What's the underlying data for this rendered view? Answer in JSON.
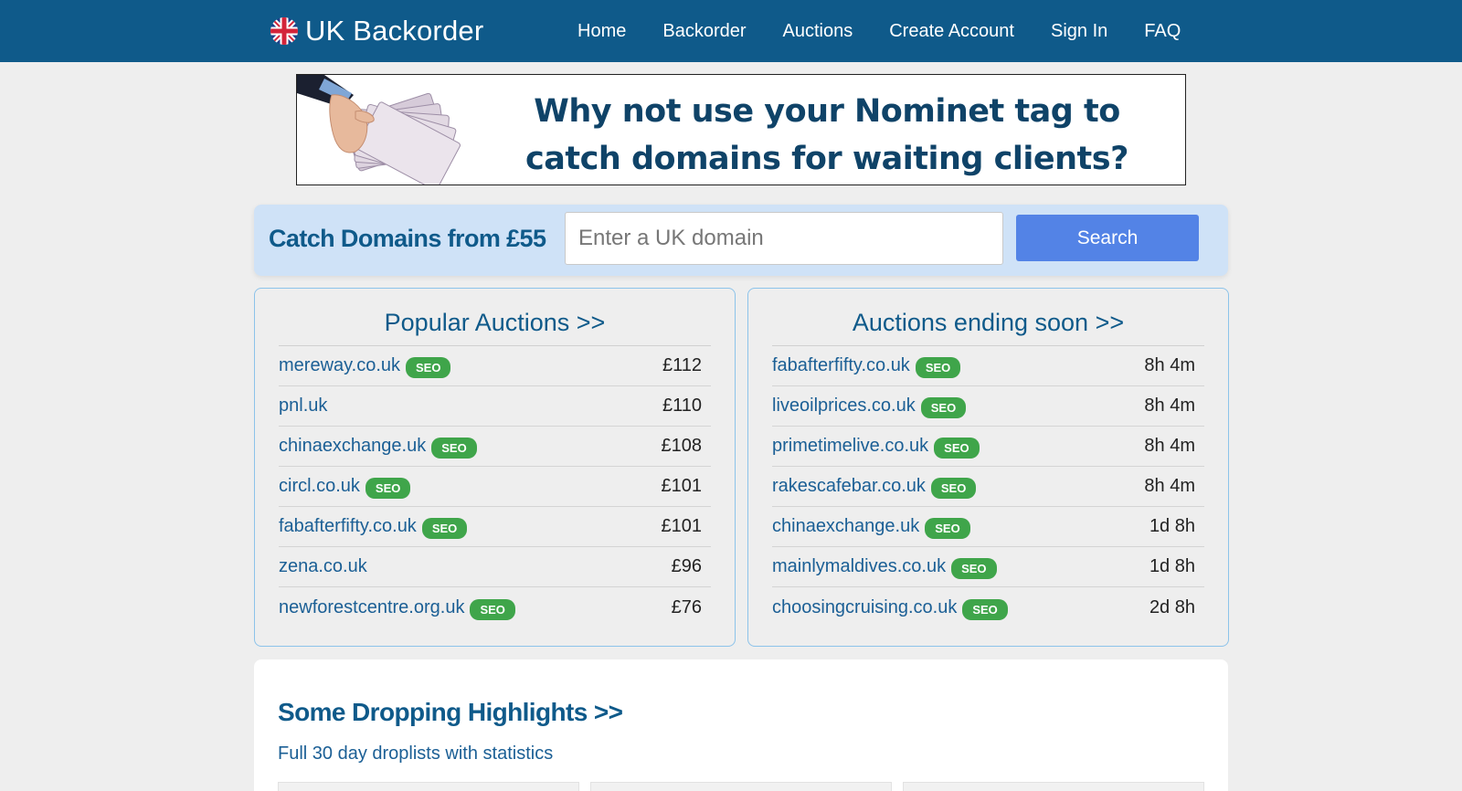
{
  "nav": {
    "brand": "UK Backorder",
    "brand_icon": "union-jack-flag-icon",
    "links": [
      "Home",
      "Backorder",
      "Auctions",
      "Create Account",
      "Sign In",
      "FAQ"
    ]
  },
  "banner": {
    "headline": "Why not use your Nominet tag to catch domains for waiting clients?",
    "image": "hand-holding-banknotes-image"
  },
  "search": {
    "title": "Catch Domains from £55",
    "placeholder": "Enter a UK domain",
    "button": "Search"
  },
  "popular": {
    "title": "Popular Auctions >>",
    "rows": [
      {
        "domain": "mereway.co.uk",
        "seo": true,
        "value": "£112"
      },
      {
        "domain": "pnl.uk",
        "seo": false,
        "value": "£110"
      },
      {
        "domain": "chinaexchange.uk",
        "seo": true,
        "value": "£108"
      },
      {
        "domain": "circl.co.uk",
        "seo": true,
        "value": "£101"
      },
      {
        "domain": "fabafterfifty.co.uk",
        "seo": true,
        "value": "£101"
      },
      {
        "domain": "zena.co.uk",
        "seo": false,
        "value": "£96"
      },
      {
        "domain": "newforestcentre.org.uk",
        "seo": true,
        "value": "£76"
      }
    ]
  },
  "ending": {
    "title": "Auctions ending soon >>",
    "rows": [
      {
        "domain": "fabafterfifty.co.uk",
        "seo": true,
        "value": "8h 4m"
      },
      {
        "domain": "liveoilprices.co.uk",
        "seo": true,
        "value": "8h 4m"
      },
      {
        "domain": "primetimelive.co.uk",
        "seo": true,
        "value": "8h 4m"
      },
      {
        "domain": "rakescafebar.co.uk",
        "seo": true,
        "value": "8h 4m"
      },
      {
        "domain": "chinaexchange.uk",
        "seo": true,
        "value": "1d 8h"
      },
      {
        "domain": "mainlymaldives.co.uk",
        "seo": true,
        "value": "1d 8h"
      },
      {
        "domain": "choosingcruising.co.uk",
        "seo": true,
        "value": "2d 8h"
      }
    ]
  },
  "seo_label": "SEO",
  "highlights": {
    "title": "Some Dropping Highlights >>",
    "subtitle": "Full 30 day droplists with statistics"
  },
  "colors": {
    "navbar": "#0f5a8a",
    "accent_blue": "#5383e6",
    "seo_green": "#3fa54a",
    "search_bg": "#cfe2f7",
    "link": "#1b5f95"
  }
}
